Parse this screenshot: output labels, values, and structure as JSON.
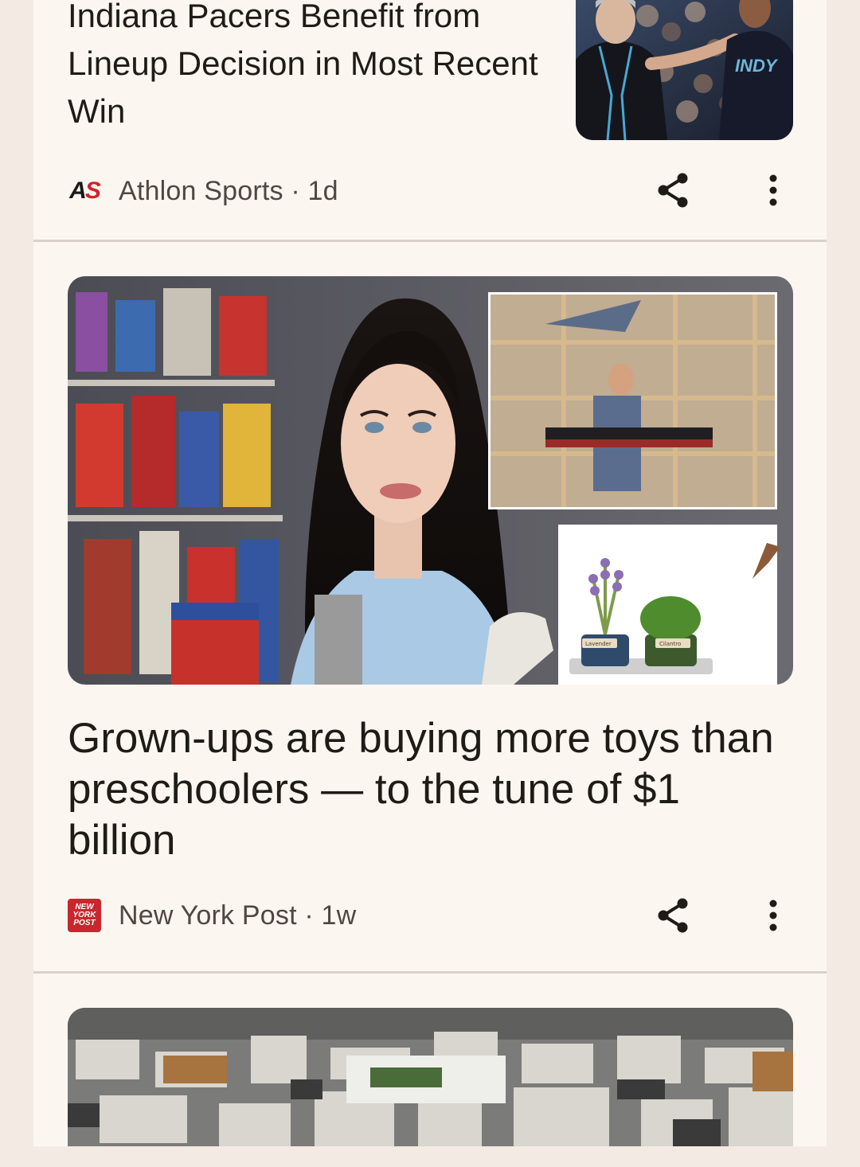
{
  "articles": [
    {
      "headline": "Indiana Pacers Benefit from Lineup Decision in Most Recent Win",
      "source": "Athlon Sports",
      "age": "1d",
      "source_meta": "Athlon Sports · 1d",
      "logo_text": "AS",
      "logo_colors": {
        "A": "#1a1a1a",
        "S": "#d2232a"
      },
      "image_label": "Basketball coach and player in jersey on court",
      "jersey_text": "INDY"
    },
    {
      "headline": "Grown-ups are buying more toys than preschoolers — to the tune of $1 billion",
      "source": "New York Post",
      "age": "1w",
      "source_meta": "New York Post · 1w",
      "logo_lines": [
        "NEW",
        "YORK",
        "POST"
      ],
      "image_label": "Woman in front of toy collection shelves with inset photos of LEGO sets",
      "plant_labels": [
        "Lavender",
        "Cilantro"
      ]
    },
    {
      "image_label": "Large pile of discarded printers and electronics"
    }
  ],
  "colors": {
    "background": "#f3ebe3",
    "card": "#fcf6f1",
    "headline": "#1f1b17",
    "meta": "#4f4741",
    "nyp_red": "#c8272e"
  },
  "icons": {
    "share": "share-icon",
    "more": "more-vert-icon"
  }
}
